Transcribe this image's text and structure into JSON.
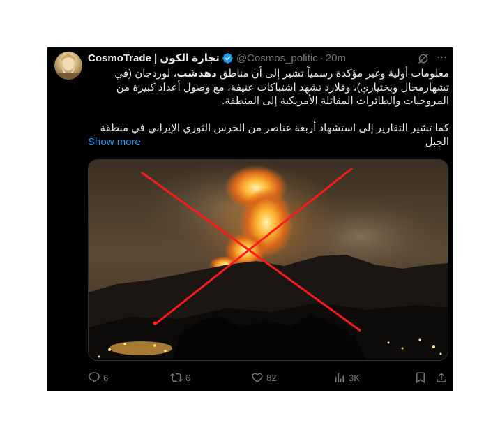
{
  "tweet": {
    "author_name": "CosmoTrade | تجارة الكون",
    "handle": "@Cosmos_politic",
    "separator": "·",
    "time": "20m",
    "paragraph1_a": "معلومات أولية وغير مؤكدة رسمياً تشير إلى أن مناطق ",
    "paragraph1_bold": "دهدشت",
    "paragraph1_b": "، لوردجان (في تشهارمحال وبختياري)، وفلارد تشهد اشتباكات عنيفة، مع وصول أعداد كبيرة من المروحيات والطائرات المقاتلة الأمريكية إلى المنطقة.",
    "paragraph2": "كما تشير التقارير إلى استشهاد أربعة عناصر من الحرس الثوري الإيراني في منطقة الجبل",
    "show_more": "Show more"
  },
  "actions": {
    "replies": "6",
    "reposts": "6",
    "likes": "82",
    "views": "3K"
  },
  "icons": {
    "verified": "verified-badge-icon",
    "grok": "grok-icon",
    "more": "more-icon",
    "reply": "reply-icon",
    "repost": "repost-icon",
    "like": "heart-icon",
    "views": "views-icon",
    "bookmark": "bookmark-icon",
    "share": "share-icon"
  },
  "colors": {
    "background": "#000000",
    "text": "#e7e9ea",
    "muted": "#71767b",
    "link": "#1d9bf0",
    "verified": "#1d9bf0",
    "cross": "#ff1a1a"
  }
}
